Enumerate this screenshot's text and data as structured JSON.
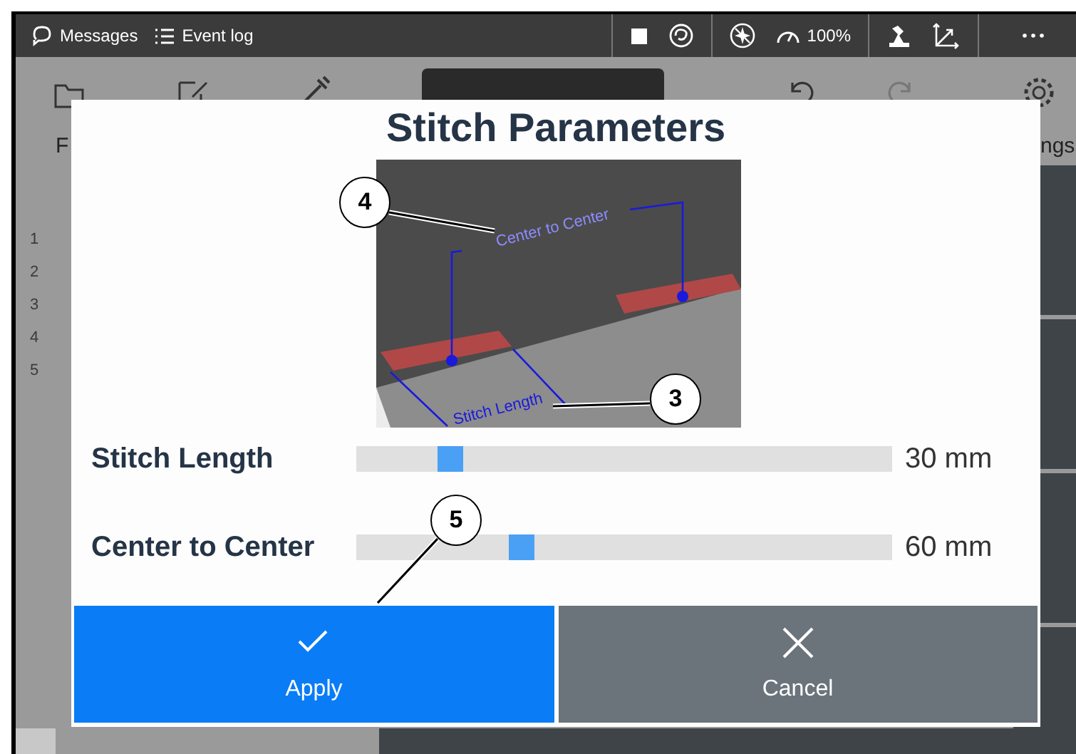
{
  "topbar": {
    "items": [
      {
        "kind": "messages",
        "label": "Messages"
      },
      {
        "kind": "eventlog",
        "label": "Event log"
      }
    ],
    "speed": "100%"
  },
  "background": {
    "toolbar_labels": [
      "F",
      "ngs"
    ],
    "line_numbers": [
      "1",
      "2",
      "3",
      "4",
      "5"
    ]
  },
  "dialog": {
    "title": "Stitch Parameters",
    "illustration": {
      "labels": [
        "Center to Center",
        "Stitch Length"
      ]
    },
    "sliders": [
      {
        "label": "Stitch Length",
        "level": 0.16,
        "reading": "30 mm"
      },
      {
        "label": "Center to Center",
        "level": 0.3,
        "reading": "60 mm"
      }
    ],
    "buttons": [
      {
        "kind": "apply",
        "label": "Apply"
      },
      {
        "kind": "cancel",
        "label": "Cancel"
      }
    ]
  },
  "callouts": [
    {
      "number": "4"
    },
    {
      "number": "3"
    },
    {
      "number": "5"
    }
  ]
}
